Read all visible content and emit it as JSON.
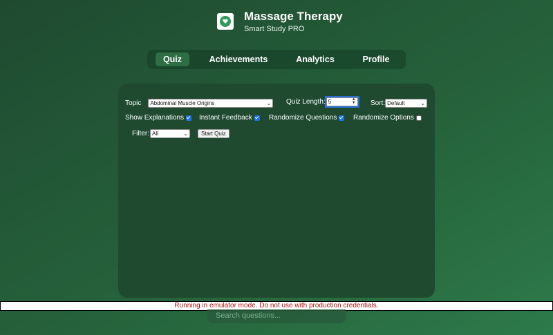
{
  "app": {
    "title": "Massage Therapy",
    "subtitle": "Smart Study PRO",
    "logo_icon": "hands-heart-icon"
  },
  "nav": {
    "tabs": [
      {
        "label": "Quiz",
        "active": true
      },
      {
        "label": "Achievements",
        "active": false
      },
      {
        "label": "Analytics",
        "active": false
      },
      {
        "label": "Profile",
        "active": false
      }
    ]
  },
  "quiz_settings": {
    "topic_label": "Topic",
    "topic_value": "Abdominal Muscle Origins",
    "length_label": "Quiz Length:",
    "length_value": "5",
    "sort_label": "Sort:",
    "sort_value": "Default",
    "options": [
      {
        "label": "Show Explanations",
        "checked": true
      },
      {
        "label": "Instant Feedback",
        "checked": true
      },
      {
        "label": "Randomize Questions",
        "checked": true
      },
      {
        "label": "Randomize Options",
        "checked": false
      }
    ],
    "filter_label": "Filter:",
    "filter_value": "All",
    "start_button": "Start Quiz"
  },
  "banner": {
    "text": "Running in emulator mode. Do not use with production credentials."
  },
  "search": {
    "placeholder": "Search questions..."
  },
  "colors": {
    "accent": "#2f6d45",
    "panel": "#1f4a30",
    "banner_text": "#b01010"
  }
}
